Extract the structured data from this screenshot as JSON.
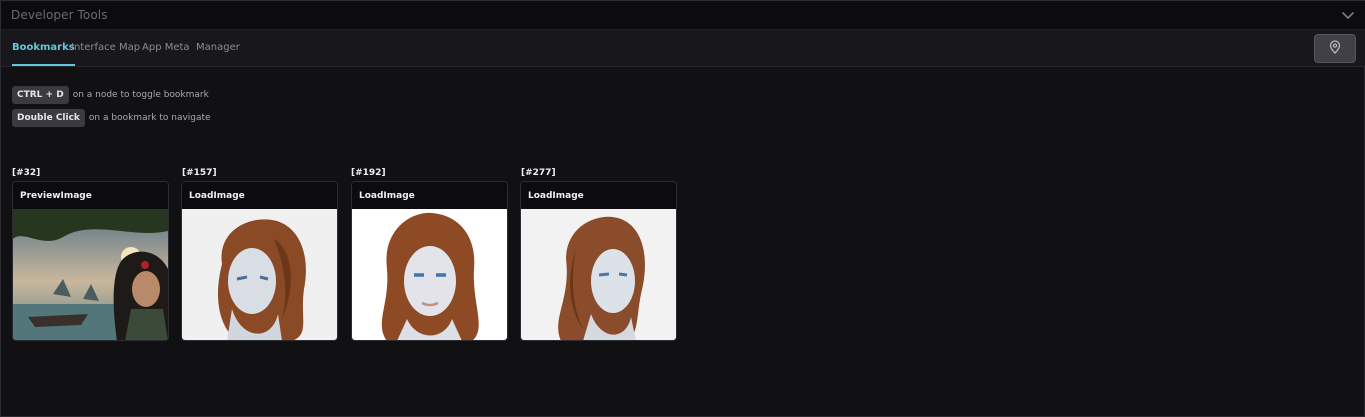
{
  "header": {
    "title": "Developer Tools",
    "collapse_icon": "chevron-down-icon"
  },
  "tabs": [
    {
      "label": "Bookmarks",
      "active": true
    },
    {
      "label": "Interface Map",
      "active": false
    },
    {
      "label": "App Meta",
      "active": false
    },
    {
      "label": "Manager",
      "active": false
    }
  ],
  "toolbar": {
    "pin_icon": "location-pin-icon"
  },
  "hints": [
    {
      "key": "CTRL + D",
      "text": "on a node to toggle bookmark"
    },
    {
      "key": "Double Click",
      "text": "on a bookmark to navigate"
    }
  ],
  "bookmarks": [
    {
      "id": "[#32]",
      "node": "PreviewImage"
    },
    {
      "id": "[#157]",
      "node": "LoadImage"
    },
    {
      "id": "[#192]",
      "node": "LoadImage"
    },
    {
      "id": "[#277]",
      "node": "LoadImage"
    }
  ],
  "colors": {
    "accent": "#64c8dc",
    "background": "#111114"
  }
}
